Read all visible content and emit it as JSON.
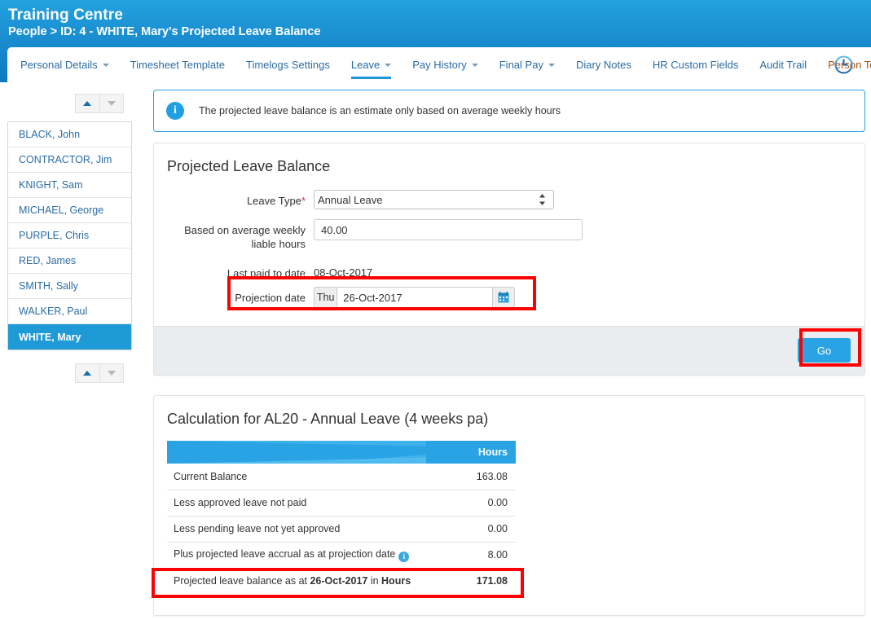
{
  "header": {
    "app_title": "Training Centre",
    "breadcrumb": "People > ID: 4 - WHITE, Mary's Projected Leave Balance",
    "clock_icon": "clock-icon",
    "brand_blue": "#1a8ed0"
  },
  "nav": {
    "items": [
      {
        "label": "Personal Details",
        "caret": true,
        "active": false,
        "orange": false
      },
      {
        "label": "Timesheet Template",
        "caret": false,
        "active": false,
        "orange": false
      },
      {
        "label": "Timelogs Settings",
        "caret": false,
        "active": false,
        "orange": false
      },
      {
        "label": "Leave",
        "caret": true,
        "active": true,
        "orange": false
      },
      {
        "label": "Pay History",
        "caret": true,
        "active": false,
        "orange": false
      },
      {
        "label": "Final Pay",
        "caret": true,
        "active": false,
        "orange": false
      },
      {
        "label": "Diary Notes",
        "caret": false,
        "active": false,
        "orange": false
      },
      {
        "label": "HR Custom Fields",
        "caret": false,
        "active": false,
        "orange": false
      },
      {
        "label": "Audit Trail",
        "caret": false,
        "active": false,
        "orange": false
      },
      {
        "label": "Person Tools",
        "caret": false,
        "active": false,
        "orange": true
      }
    ]
  },
  "sidebar": {
    "pager_top": {
      "up_icon": "chevron-up-icon",
      "down_icon": "chevron-down-icon"
    },
    "pager_bottom": {
      "up_icon": "chevron-up-icon",
      "down_icon": "chevron-down-icon"
    },
    "people": [
      {
        "name": "BLACK, John",
        "selected": false
      },
      {
        "name": "CONTRACTOR, Jim",
        "selected": false
      },
      {
        "name": "KNIGHT, Sam",
        "selected": false
      },
      {
        "name": "MICHAEL, George",
        "selected": false
      },
      {
        "name": "PURPLE, Chris",
        "selected": false
      },
      {
        "name": "RED, James",
        "selected": false
      },
      {
        "name": "SMITH, Sally",
        "selected": false
      },
      {
        "name": "WALKER, Paul",
        "selected": false
      },
      {
        "name": "WHITE, Mary",
        "selected": true
      }
    ]
  },
  "banner": {
    "icon": "info-icon",
    "text": "The projected leave balance is an estimate only based on average weekly hours"
  },
  "form_card": {
    "title": "Projected Leave Balance",
    "leave_type": {
      "label": "Leave Type",
      "required_marker": "*",
      "value": "Annual Leave",
      "options": [
        "Annual Leave"
      ]
    },
    "avg_hours": {
      "label_line1": "Based on average weekly",
      "label_line2": "liable hours",
      "value": "40.00",
      "placeholder": ""
    },
    "last_paid": {
      "label": "Last paid to date",
      "value": "08-Oct-2017"
    },
    "projection_date": {
      "label": "Projection date",
      "day_of_week": "Thu",
      "value": "26-Oct-2017",
      "placeholder": "",
      "calendar_icon": "calendar-icon"
    },
    "go_label": "Go"
  },
  "results_card": {
    "title": "Calculation for AL20 - Annual Leave (4 weeks pa)",
    "columns": [
      "",
      "Hours"
    ],
    "rows": [
      {
        "label": "Current Balance",
        "amount": "163.08",
        "info_icon": false,
        "total": false
      },
      {
        "label": "Less approved leave not paid",
        "amount": "0.00",
        "info_icon": false,
        "total": false
      },
      {
        "label": "Less pending leave not yet approved",
        "amount": "0.00",
        "info_icon": false,
        "total": false
      },
      {
        "label": "Plus projected leave accrual as at projection date",
        "amount": "8.00",
        "info_icon": true,
        "total": false
      },
      {
        "label_prefix": "Projected leave balance as at ",
        "label_bold1": "26-Oct-2017",
        "label_mid": " in ",
        "label_bold2": "Hours",
        "amount": "171.08",
        "info_icon": false,
        "total": true
      }
    ]
  },
  "annotations": {
    "highlight_color": "#ff0000",
    "boxes": [
      "projection-date-field",
      "go-button",
      "projected-balance-row"
    ]
  }
}
